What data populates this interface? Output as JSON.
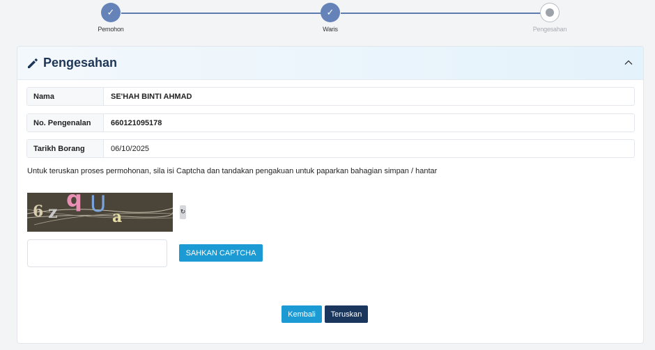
{
  "stepper": {
    "steps": [
      {
        "label": "Pemohon",
        "status": "done"
      },
      {
        "label": "Waris",
        "status": "done"
      },
      {
        "label": "Pengesahan",
        "status": "current"
      }
    ]
  },
  "card": {
    "title": "Pengesahan",
    "icon": "pencil-icon",
    "collapse_icon": "chevron-up-icon"
  },
  "info": {
    "nama": {
      "label": "Nama",
      "value": "SE'HAH BINTI AHMAD"
    },
    "pengenalan": {
      "label": "No. Pengenalan",
      "value": "660121095178"
    },
    "tarikh": {
      "label": "Tarikh Borang",
      "value": "06/10/2025"
    }
  },
  "instruction": "Untuk teruskan proses permohonan, sila isi Captcha dan tandakan pengakuan untuk paparkan bahagian simpan / hantar",
  "captcha": {
    "chars": [
      "6",
      "z",
      "q",
      "U",
      "a"
    ],
    "refresh_icon": "refresh-icon",
    "input_value": "",
    "input_placeholder": "",
    "button_label": "SAHKAN CAPTCHA"
  },
  "actions": {
    "back_label": "Kembali",
    "next_label": "Teruskan"
  },
  "colors": {
    "step_done": "#6583b8",
    "primary": "#1c9ad4",
    "dark": "#1b365d"
  }
}
